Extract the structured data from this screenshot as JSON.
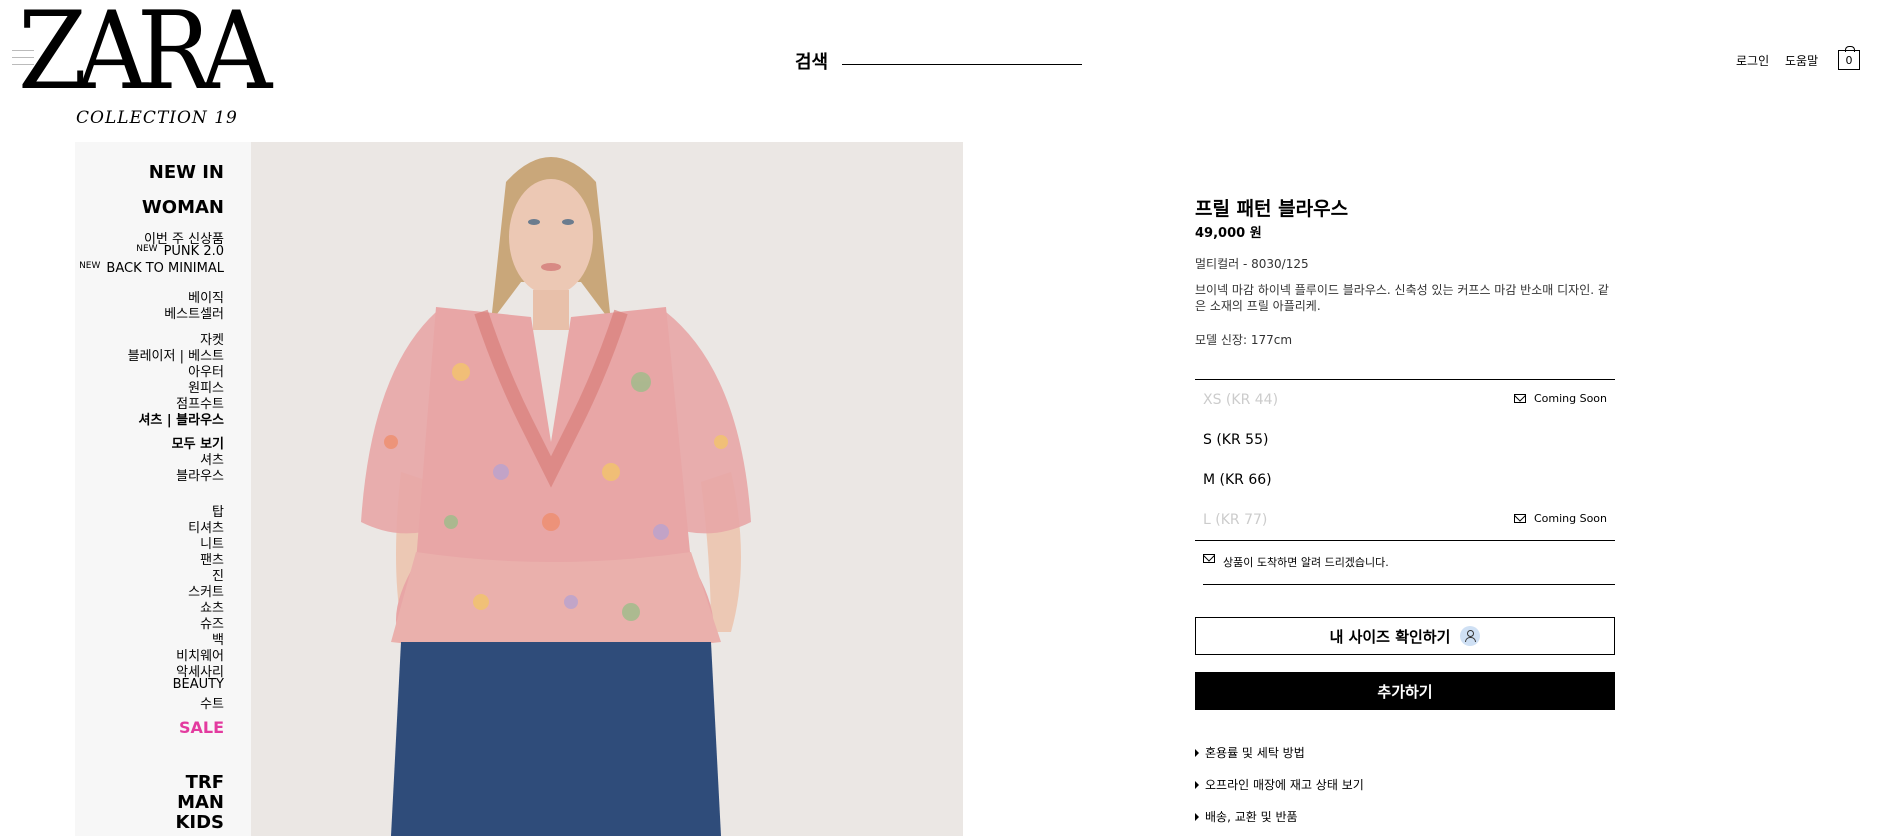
{
  "header": {
    "logo": "ZARA",
    "logo_sub": "COLLECTION 19",
    "search_label": "검색",
    "login": "로그인",
    "help": "도움말",
    "cart_count": "0"
  },
  "sidebar": {
    "new_in": "NEW IN",
    "woman": "WOMAN",
    "items": [
      {
        "label": "이번 주 신상품"
      },
      {
        "label": "PUNK 2.0",
        "tag": "NEW"
      },
      {
        "label": "BACK TO MINIMAL",
        "tag": "NEW"
      },
      {
        "label": "베이직"
      },
      {
        "label": "베스트셀러"
      },
      {
        "label": "자켓"
      },
      {
        "label": "블레이저 | 베스트"
      },
      {
        "label": "아우터"
      },
      {
        "label": "원피스"
      },
      {
        "label": "점프수트"
      },
      {
        "label": "셔츠 | 블라우스"
      },
      {
        "label": "모두 보기"
      },
      {
        "label": "셔츠"
      },
      {
        "label": "블라우스"
      },
      {
        "label": "탑"
      },
      {
        "label": "티셔츠"
      },
      {
        "label": "니트"
      },
      {
        "label": "팬츠"
      },
      {
        "label": "진"
      },
      {
        "label": "스커트"
      },
      {
        "label": "쇼츠"
      },
      {
        "label": "슈즈"
      },
      {
        "label": "백"
      },
      {
        "label": "비치웨어"
      },
      {
        "label": "악세사리"
      },
      {
        "label": "BEAUTY"
      },
      {
        "label": "수트"
      }
    ],
    "sale": "SALE",
    "trf": "TRF",
    "man": "MAN",
    "kids": "KIDS"
  },
  "product": {
    "title": "프릴 패턴 블라우스",
    "price": "49,000 원",
    "color": "멀티컬러 - 8030/125",
    "description": "브이넥 마감 하이넥 플루이드 블라우스. 신축성 있는 커프스 마감 반소매 디자인. 같은 소재의 프릴 아플리케.",
    "model_height": "모델 신장: 177cm",
    "sizes": [
      {
        "label": "XS (KR 44)",
        "available": false,
        "status": "Coming Soon"
      },
      {
        "label": "S (KR 55)",
        "available": true,
        "status": ""
      },
      {
        "label": "M (KR 66)",
        "available": true,
        "status": ""
      },
      {
        "label": "L (KR 77)",
        "available": false,
        "status": "Coming Soon"
      }
    ],
    "notify": "상품이 도착하면 알려 드리겠습니다.",
    "size_check": "내 사이즈 확인하기",
    "add": "추가하기",
    "links": [
      "혼용률 및 세탁 방법",
      "오프라인 매장에 재고 상태 보기",
      "배송, 교환 및 반품"
    ]
  },
  "colors": {
    "sale": "#e33a9f",
    "photo_bg": "#ebe7e4",
    "blouse": "#e8a6a6",
    "jeans": "#2f4c7a"
  }
}
